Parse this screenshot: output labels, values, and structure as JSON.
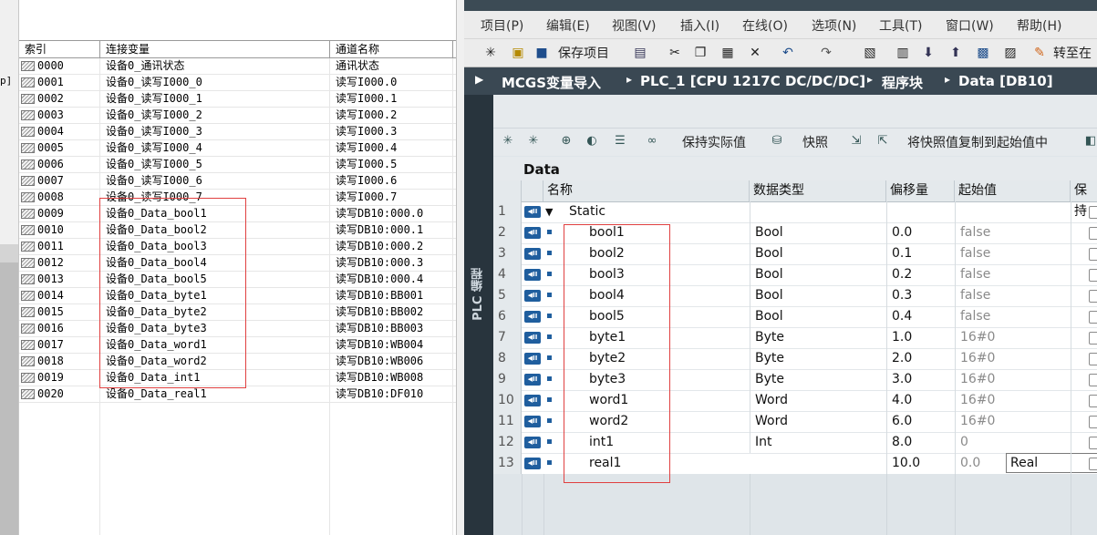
{
  "mcgs_table": {
    "headers": {
      "index": "索引",
      "variable": "连接变量",
      "channel": "通道名称"
    },
    "rows": [
      {
        "index": "0000",
        "variable": "设备0_通讯状态",
        "channel": "通讯状态"
      },
      {
        "index": "0001",
        "variable": "设备0_读写I000_0",
        "channel": "读写I000.0"
      },
      {
        "index": "0002",
        "variable": "设备0_读写I000_1",
        "channel": "读写I000.1"
      },
      {
        "index": "0003",
        "variable": "设备0_读写I000_2",
        "channel": "读写I000.2"
      },
      {
        "index": "0004",
        "variable": "设备0_读写I000_3",
        "channel": "读写I000.3"
      },
      {
        "index": "0005",
        "variable": "设备0_读写I000_4",
        "channel": "读写I000.4"
      },
      {
        "index": "0006",
        "variable": "设备0_读写I000_5",
        "channel": "读写I000.5"
      },
      {
        "index": "0007",
        "variable": "设备0_读写I000_6",
        "channel": "读写I000.6"
      },
      {
        "index": "0008",
        "variable": "设备0_读写I000_7",
        "channel": "读写I000.7"
      },
      {
        "index": "0009",
        "variable": "设备0_Data_bool1",
        "channel": "读写DB10:000.0"
      },
      {
        "index": "0010",
        "variable": "设备0_Data_bool2",
        "channel": "读写DB10:000.1"
      },
      {
        "index": "0011",
        "variable": "设备0_Data_bool3",
        "channel": "读写DB10:000.2"
      },
      {
        "index": "0012",
        "variable": "设备0_Data_bool4",
        "channel": "读写DB10:000.3"
      },
      {
        "index": "0013",
        "variable": "设备0_Data_bool5",
        "channel": "读写DB10:000.4"
      },
      {
        "index": "0014",
        "variable": "设备0_Data_byte1",
        "channel": "读写DB10:BB001"
      },
      {
        "index": "0015",
        "variable": "设备0_Data_byte2",
        "channel": "读写DB10:BB002"
      },
      {
        "index": "0016",
        "variable": "设备0_Data_byte3",
        "channel": "读写DB10:BB003"
      },
      {
        "index": "0017",
        "variable": "设备0_Data_word1",
        "channel": "读写DB10:WB004"
      },
      {
        "index": "0018",
        "variable": "设备0_Data_word2",
        "channel": "读写DB10:WB006"
      },
      {
        "index": "0019",
        "variable": "设备0_Data_int1",
        "channel": "读写DB10:WB008"
      },
      {
        "index": "0020",
        "variable": "设备0_Data_real1",
        "channel": "读写DB10:DF010"
      }
    ]
  },
  "tia": {
    "menu": [
      "项目(P)",
      "编辑(E)",
      "视图(V)",
      "插入(I)",
      "在线(O)",
      "选项(N)",
      "工具(T)",
      "窗口(W)",
      "帮助(H)"
    ],
    "toolbar": {
      "save_label": "保存项目",
      "goto_online_label": "转至在"
    },
    "breadcrumb": [
      "MCGS变量导入",
      "PLC_1 [CPU 1217C DC/DC/DC]",
      "程序块",
      "Data [DB10]"
    ],
    "side_tab": "PLC 编程",
    "block_toolbar": {
      "keep_actual_label": "保持实际值",
      "snapshot_label": "快照",
      "copy_snapshot_label": "将快照值复制到起始值中"
    },
    "db_title": "Data",
    "columns": {
      "name": "名称",
      "type": "数据类型",
      "offset": "偏移量",
      "start": "起始值",
      "retain": "保持"
    },
    "root": {
      "num": "1",
      "name": "Static"
    },
    "rows": [
      {
        "num": "2",
        "name": "bool1",
        "type": "Bool",
        "offset": "0.0",
        "start": "false"
      },
      {
        "num": "3",
        "name": "bool2",
        "type": "Bool",
        "offset": "0.1",
        "start": "false"
      },
      {
        "num": "4",
        "name": "bool3",
        "type": "Bool",
        "offset": "0.2",
        "start": "false"
      },
      {
        "num": "5",
        "name": "bool4",
        "type": "Bool",
        "offset": "0.3",
        "start": "false"
      },
      {
        "num": "6",
        "name": "bool5",
        "type": "Bool",
        "offset": "0.4",
        "start": "false"
      },
      {
        "num": "7",
        "name": "byte1",
        "type": "Byte",
        "offset": "1.0",
        "start": "16#0"
      },
      {
        "num": "8",
        "name": "byte2",
        "type": "Byte",
        "offset": "2.0",
        "start": "16#0"
      },
      {
        "num": "9",
        "name": "byte3",
        "type": "Byte",
        "offset": "3.0",
        "start": "16#0"
      },
      {
        "num": "10",
        "name": "word1",
        "type": "Word",
        "offset": "4.0",
        "start": "16#0"
      },
      {
        "num": "11",
        "name": "word2",
        "type": "Word",
        "offset": "6.0",
        "start": "16#0"
      },
      {
        "num": "12",
        "name": "int1",
        "type": "Int",
        "offset": "8.0",
        "start": "0"
      },
      {
        "num": "13",
        "name": "real1",
        "type": "Real",
        "offset": "10.0",
        "start": "0.0"
      }
    ]
  },
  "colors": {
    "highlight_box": "#e04040",
    "tia_dark": "#2d3a43",
    "io_icon": "#1f5e9e"
  }
}
